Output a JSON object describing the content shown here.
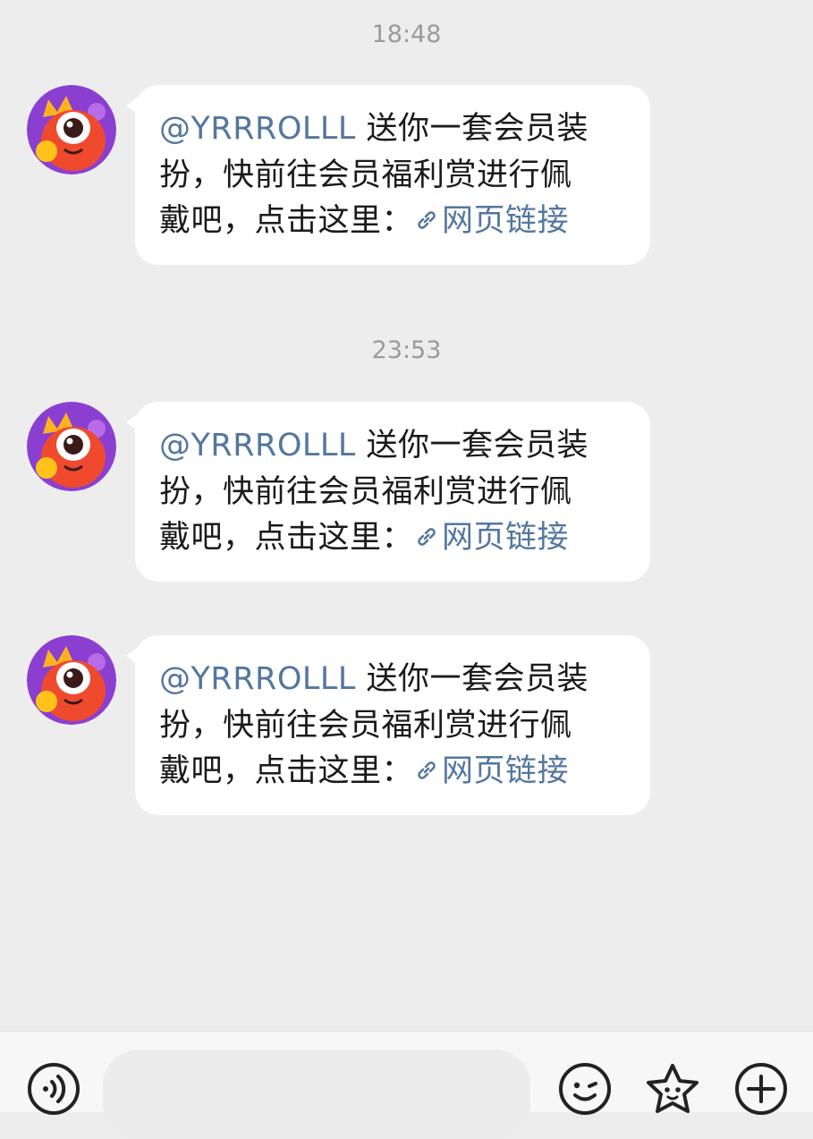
{
  "messages": [
    {
      "time": "18:48",
      "mention": "@YRRROLLL",
      "text_line1": " 送你一套会员装",
      "text_line2": "扮，快前往会员福利赏进行佩",
      "text_line3": "戴吧，点击这里：",
      "link_label": "网页链接"
    },
    {
      "time": "23:53",
      "mention": "@YRRROLLL",
      "text_line1": " 送你一套会员装",
      "text_line2": "扮，快前往会员福利赏进行佩",
      "text_line3": "戴吧，点击这里：",
      "link_label": "网页链接"
    },
    {
      "time": "",
      "mention": "@YRRROLLL",
      "text_line1": " 送你一套会员装",
      "text_line2": "扮，快前往会员福利赏进行佩",
      "text_line3": "戴吧，点击这里：",
      "link_label": "网页链接"
    }
  ],
  "input": {
    "value": "",
    "placeholder": ""
  },
  "icons": {
    "voice": "voice-icon",
    "emoji": "emoji-icon",
    "sticker": "star-sticker-icon",
    "plus": "plus-icon"
  },
  "colors": {
    "background": "#ededed",
    "bubble": "#ffffff",
    "link": "#53779e",
    "avatar_bg": "#8a3fd1",
    "avatar_monster": "#ef4a2e"
  }
}
